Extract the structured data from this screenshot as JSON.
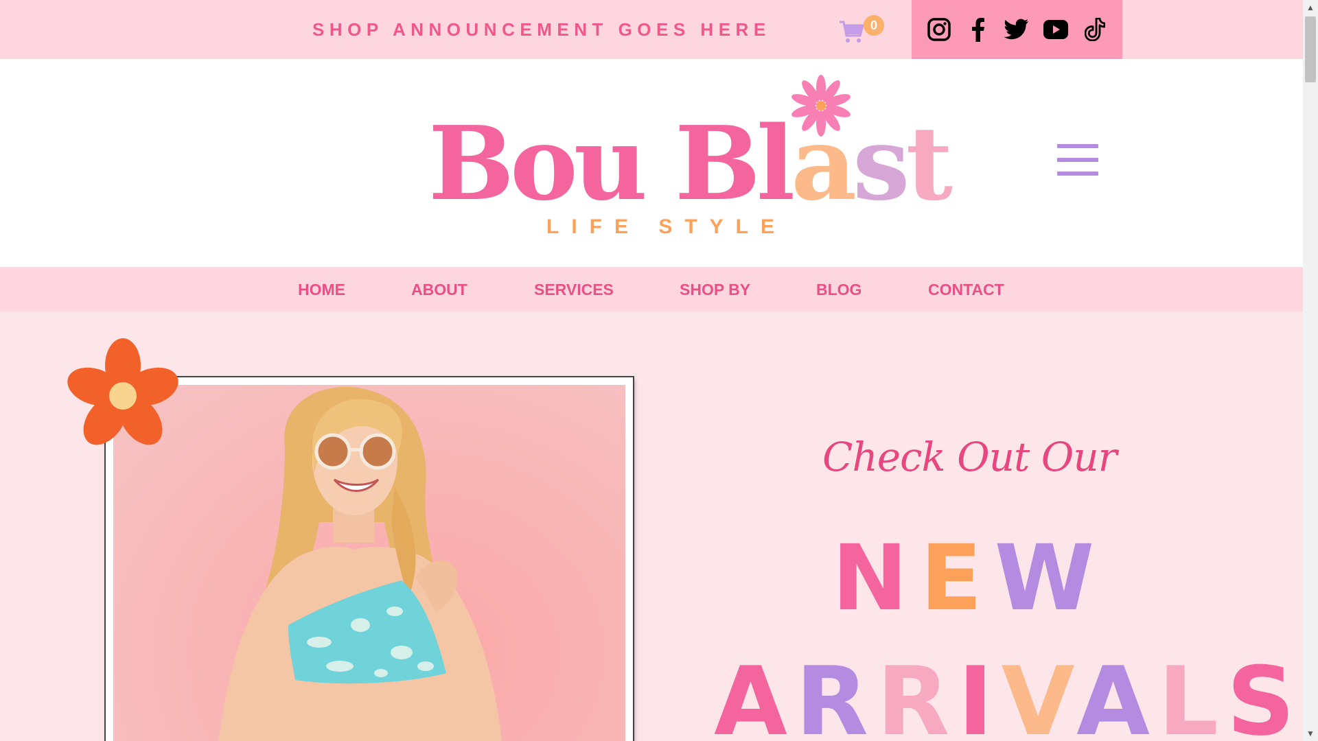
{
  "topbar": {
    "announcement": "SHOP ANNOUNCEMENT GOES HERE",
    "cart": {
      "icon": "cart-icon",
      "count": "0"
    },
    "social": [
      {
        "name": "instagram-icon"
      },
      {
        "name": "facebook-icon"
      },
      {
        "name": "twitter-icon"
      },
      {
        "name": "youtube-icon"
      },
      {
        "name": "tiktok-icon"
      }
    ]
  },
  "header": {
    "logo": {
      "title_parts": [
        "Bou ",
        "Bl",
        "a",
        "s",
        "t"
      ],
      "subtitle": "LIFE STYLE"
    },
    "menu_icon": "hamburger-menu-icon"
  },
  "nav": {
    "items": [
      "HOME",
      "ABOUT",
      "SERVICES",
      "SHOP BY",
      "BLOG",
      "CONTACT"
    ]
  },
  "hero": {
    "script": "Check Out Our",
    "headline_line1": [
      "N",
      "E",
      "W"
    ],
    "headline_line2": [
      "A",
      "R",
      "R",
      "I",
      "V",
      "A",
      "L",
      "S"
    ]
  },
  "colors": {
    "pink": "#f4649d",
    "peach": "#fcb98a",
    "lavender": "#d6a6d6",
    "orange": "#fca15a",
    "purple": "#b48be0",
    "announce": "#f0588c",
    "social_bg": "#fc9ab8",
    "topbar_bg": "#fdd6e0"
  }
}
